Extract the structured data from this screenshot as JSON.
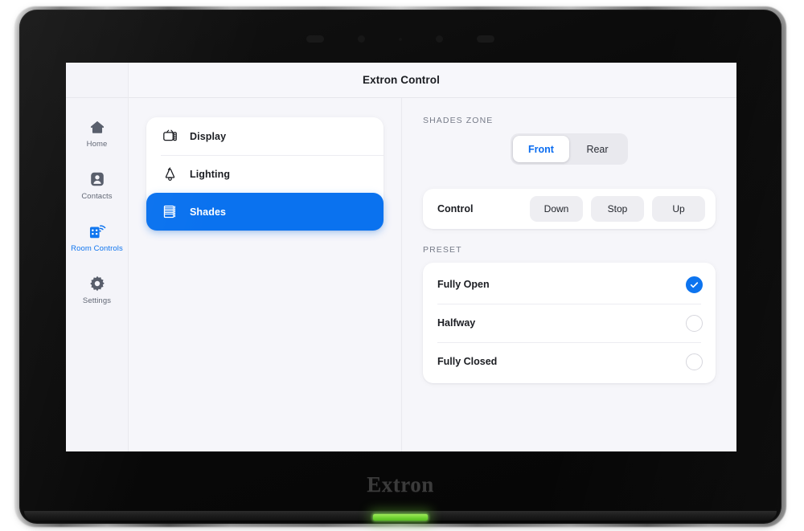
{
  "device": {
    "brand": "Extron",
    "led_color": "#78dc3c",
    "bezel_color": "#0a0a0a"
  },
  "screen": {
    "header": {
      "title": "Extron Control"
    },
    "accent_color": "#0a72ef",
    "background_color": "#f6f6fa"
  },
  "sidebar": {
    "items": [
      {
        "label": "Home",
        "icon": "home-icon",
        "active": false
      },
      {
        "label": "Contacts",
        "icon": "contacts-icon",
        "active": false
      },
      {
        "label": "Room Controls",
        "icon": "room-controls-icon",
        "active": true
      },
      {
        "label": "Settings",
        "icon": "gear-icon",
        "active": false
      }
    ]
  },
  "sources": {
    "items": [
      {
        "label": "Display",
        "icon": "tv-icon",
        "selected": false
      },
      {
        "label": "Lighting",
        "icon": "lamp-icon",
        "selected": false
      },
      {
        "label": "Shades",
        "icon": "blinds-icon",
        "selected": true
      }
    ]
  },
  "shades_zone": {
    "label": "SHADES ZONE",
    "options": [
      {
        "label": "Front",
        "active": true
      },
      {
        "label": "Rear",
        "active": false
      }
    ]
  },
  "control": {
    "label": "Control",
    "buttons": [
      {
        "label": "Down"
      },
      {
        "label": "Stop"
      },
      {
        "label": "Up"
      }
    ]
  },
  "preset": {
    "label": "PRESET",
    "items": [
      {
        "label": "Fully Open",
        "selected": true
      },
      {
        "label": "Halfway",
        "selected": false
      },
      {
        "label": "Fully Closed",
        "selected": false
      }
    ]
  }
}
